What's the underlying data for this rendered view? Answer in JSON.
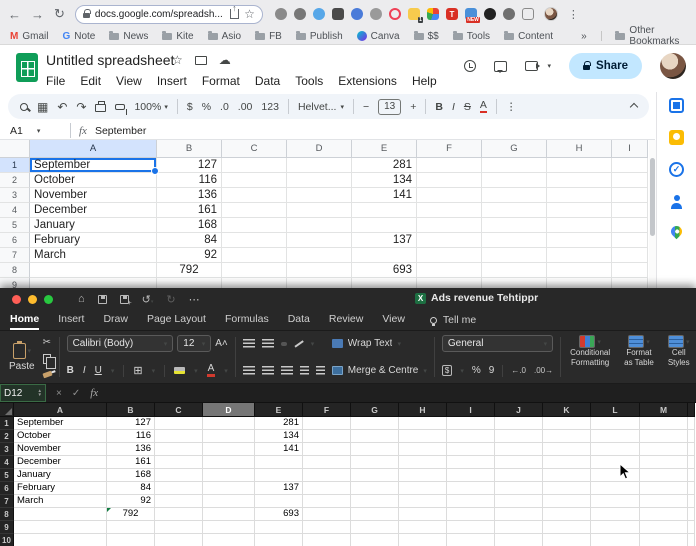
{
  "browser": {
    "url": "docs.google.com/spreadsh...",
    "more": "»",
    "other_bookmarks": "Other Bookmarks",
    "bookmarks": [
      {
        "label": "Gmail",
        "icon": "gmail"
      },
      {
        "label": "Note",
        "icon": "google-g"
      },
      {
        "label": "News",
        "icon": "folder"
      },
      {
        "label": "Kite",
        "icon": "folder"
      },
      {
        "label": "Asio",
        "icon": "folder"
      },
      {
        "label": "FB",
        "icon": "folder"
      },
      {
        "label": "Publish",
        "icon": "folder"
      },
      {
        "label": "Canva",
        "icon": "canva"
      },
      {
        "label": "$$",
        "icon": "folder"
      },
      {
        "label": "Tools",
        "icon": "folder"
      },
      {
        "label": "Content",
        "icon": "folder"
      }
    ],
    "extensions": [
      {
        "name": "pin-extension-icon",
        "color": "#8a8a8a",
        "shape": "blob"
      },
      {
        "name": "mic-extension-icon",
        "color": "#777777",
        "shape": "blob"
      },
      {
        "name": "chat-extension-icon",
        "color": "#57a7e8",
        "shape": "circle"
      },
      {
        "name": "image-extension-icon",
        "color": "#4a4a4a",
        "shape": "square"
      },
      {
        "name": "tag-extension-icon",
        "color": "#4a7bd9",
        "shape": "circle"
      },
      {
        "name": "feather-extension-icon",
        "color": "#9a9a9a",
        "shape": "blob"
      },
      {
        "name": "pocket-extension-icon",
        "color": "#ef4056",
        "shape": "ring"
      },
      {
        "name": "notes-extension-icon",
        "color": "#f7cb4d",
        "shape": "square",
        "badge": "1",
        "badge_color": "#3c4043"
      },
      {
        "name": "window-extension-icon",
        "color": "multi",
        "shape": "square"
      },
      {
        "name": "translate-extension-icon",
        "color": "#d93025",
        "shape": "square",
        "letter": "T"
      },
      {
        "name": "newtab-extension-icon",
        "color": "#4a90d9",
        "shape": "square",
        "badge": "NEW",
        "badge_color": "#d93025"
      },
      {
        "name": "pacman-extension-icon",
        "color": "#222222",
        "shape": "circle"
      },
      {
        "name": "puzzle-extension-icon",
        "color": "#6f6f6f",
        "shape": "blob"
      },
      {
        "name": "reader-extension-icon",
        "color": "#8a8a8a",
        "shape": "frame"
      }
    ]
  },
  "sheets": {
    "title": "Untitled spreadsheet",
    "menus": [
      "File",
      "Edit",
      "View",
      "Insert",
      "Format",
      "Data",
      "Tools",
      "Extensions",
      "Help"
    ],
    "share_label": "Share",
    "toolbar": {
      "zoom": "100%",
      "currency": "$",
      "percent": "%",
      "dec_dec": ".0",
      "dec_inc": ".00",
      "fmt_123": "123",
      "font_name": "Helvet...",
      "font_size": "13",
      "minus": "−",
      "plus": "+",
      "bold": "B",
      "italic": "I",
      "strike": "S",
      "text_color": "A"
    },
    "name_box": "A1",
    "formula_value": "September",
    "columns": [
      "A",
      "B",
      "C",
      "D",
      "E",
      "F",
      "G",
      "H",
      "I"
    ],
    "row_numbers": [
      "1",
      "2",
      "3",
      "4",
      "5",
      "6",
      "7",
      "8",
      "9"
    ],
    "selected_cell": "A1"
  },
  "excel": {
    "window_title": "Ads revenue Tehtippr",
    "ribbon_tabs": [
      "Home",
      "Insert",
      "Draw",
      "Page Layout",
      "Formulas",
      "Data",
      "Review",
      "View"
    ],
    "active_tab": "Home",
    "tell_me": "Tell me",
    "home_ribbon": {
      "paste": "Paste",
      "font_name": "Calibri (Body)",
      "font_size": "12",
      "bold": "B",
      "italic": "I",
      "underline": "U",
      "wrap_text": "Wrap Text",
      "merge_centre": "Merge & Centre",
      "number_format": "General",
      "percent": "%",
      "comma": "9",
      "cond_fmt_line1": "Conditional",
      "cond_fmt_line2": "Formatting",
      "fmt_table_line1": "Format",
      "fmt_table_line2": "as Table",
      "cell_styles_line1": "Cell",
      "cell_styles_line2": "Styles"
    },
    "name_box": "D12",
    "fx_label": "fx",
    "columns": [
      "A",
      "B",
      "C",
      "D",
      "E",
      "F",
      "G",
      "H",
      "I",
      "J",
      "K",
      "L",
      "M"
    ],
    "selected_column": "D",
    "row_numbers": [
      "1",
      "2",
      "3",
      "4",
      "5",
      "6",
      "7",
      "8",
      "9",
      "10"
    ]
  },
  "spreadsheet": {
    "rows": [
      {
        "a": "September",
        "b": "127",
        "e": "281"
      },
      {
        "a": "October",
        "b": "116",
        "e": "134"
      },
      {
        "a": "November",
        "b": "136",
        "e": "141"
      },
      {
        "a": "December",
        "b": "161",
        "e": ""
      },
      {
        "a": "January",
        "b": "168",
        "e": ""
      },
      {
        "a": "February",
        "b": "84",
        "e": "137"
      },
      {
        "a": "March",
        "b": "92",
        "e": ""
      },
      {
        "a": "",
        "b": "792",
        "e": "693"
      }
    ]
  },
  "colors": {
    "accent_blue": "#1a73e8",
    "share_bg": "#c2e7ff",
    "sheets_green": "#0f9d58",
    "excel_green": "#1d6f42",
    "selected_header": "#d3e3fd",
    "error_triangle_green": "#107c41"
  }
}
